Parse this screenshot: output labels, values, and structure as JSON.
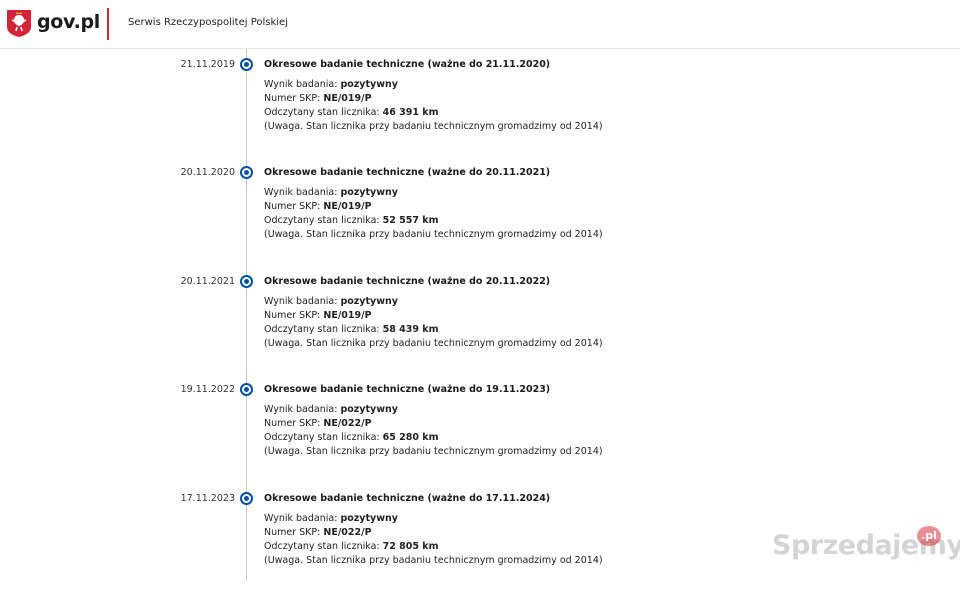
{
  "header": {
    "logo_text": "gov.pl",
    "service_name": "Serwis Rzeczypospolitej Polskiej",
    "accent_color": "#d5233a"
  },
  "timeline": {
    "marker_color": "#0052a5",
    "entries": [
      {
        "date": "21.11.2019",
        "title": "Okresowe badanie techniczne (ważne do 21.11.2020)",
        "result_label": "Wynik badania: ",
        "result_value": "pozytywny",
        "skp_label": "Numer SKP: ",
        "skp_value": "NE/019/P",
        "odometer_label": "Odczytany stan licznika: ",
        "odometer_value": "46 391 km",
        "note": "(Uwaga. Stan licznika przy badaniu technicznym gromadzimy od 2014)"
      },
      {
        "date": "20.11.2020",
        "title": "Okresowe badanie techniczne (ważne do 20.11.2021)",
        "result_label": "Wynik badania: ",
        "result_value": "pozytywny",
        "skp_label": "Numer SKP: ",
        "skp_value": "NE/019/P",
        "odometer_label": "Odczytany stan licznika: ",
        "odometer_value": "52 557 km",
        "note": "(Uwaga. Stan licznika przy badaniu technicznym gromadzimy od 2014)"
      },
      {
        "date": "20.11.2021",
        "title": "Okresowe badanie techniczne (ważne do 20.11.2022)",
        "result_label": "Wynik badania: ",
        "result_value": "pozytywny",
        "skp_label": "Numer SKP: ",
        "skp_value": "NE/019/P",
        "odometer_label": "Odczytany stan licznika: ",
        "odometer_value": "58 439 km",
        "note": "(Uwaga. Stan licznika przy badaniu technicznym gromadzimy od 2014)"
      },
      {
        "date": "19.11.2022",
        "title": "Okresowe badanie techniczne (ważne do 19.11.2023)",
        "result_label": "Wynik badania: ",
        "result_value": "pozytywny",
        "skp_label": "Numer SKP: ",
        "skp_value": "NE/022/P",
        "odometer_label": "Odczytany stan licznika: ",
        "odometer_value": "65 280 km",
        "note": "(Uwaga. Stan licznika przy badaniu technicznym gromadzimy od 2014)"
      },
      {
        "date": "17.11.2023",
        "title": "Okresowe badanie techniczne (ważne do 17.11.2024)",
        "result_label": "Wynik badania: ",
        "result_value": "pozytywny",
        "skp_label": "Numer SKP: ",
        "skp_value": "NE/022/P",
        "odometer_label": "Odczytany stan licznika: ",
        "odometer_value": "72 805 km",
        "note": "(Uwaga. Stan licznika przy badaniu technicznym gromadzimy od 2014)"
      }
    ]
  },
  "watermark": {
    "text": "Sprzedajemy",
    "badge": ".pl"
  }
}
